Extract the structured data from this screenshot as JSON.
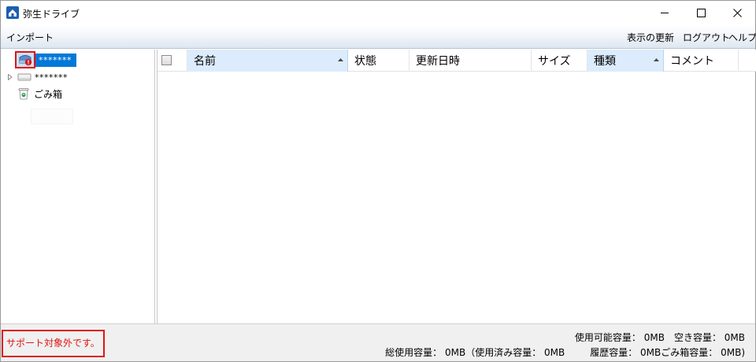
{
  "window": {
    "title": "弥生ドライブ"
  },
  "menu": {
    "import_label": "インポート",
    "refresh_label": "表示の更新",
    "logout_label": "ログアウト",
    "help_label": "ヘルプ"
  },
  "tree": {
    "items": [
      {
        "label": "*******",
        "selected": true,
        "icon": "drive-warning-icon"
      },
      {
        "label": "*******",
        "selected": false,
        "icon": "drive-icon"
      },
      {
        "label": "ごみ箱",
        "selected": false,
        "icon": "trash-icon"
      }
    ]
  },
  "list": {
    "columns": [
      {
        "label": "名前",
        "sorted": true
      },
      {
        "label": "状態",
        "sorted": false
      },
      {
        "label": "更新日時",
        "sorted": false
      },
      {
        "label": "サイズ",
        "sorted": false
      },
      {
        "label": "種類",
        "sorted": true
      },
      {
        "label": "コメント",
        "sorted": false
      }
    ],
    "rows": []
  },
  "status": {
    "message": "サポート対象外です。",
    "available_capacity": "使用可能容量： 0MB",
    "free_capacity": "空き容量：  0MB",
    "total_used": "総使用容量： 0MB（使用済み容量： 0MB",
    "history_capacity": "履歴容量： 0MB",
    "trash_capacity": "ごみ箱容量： 0MB)"
  },
  "colors": {
    "accent": "#0078d7",
    "error": "#e01414",
    "selected_column": "#dcecfc"
  }
}
